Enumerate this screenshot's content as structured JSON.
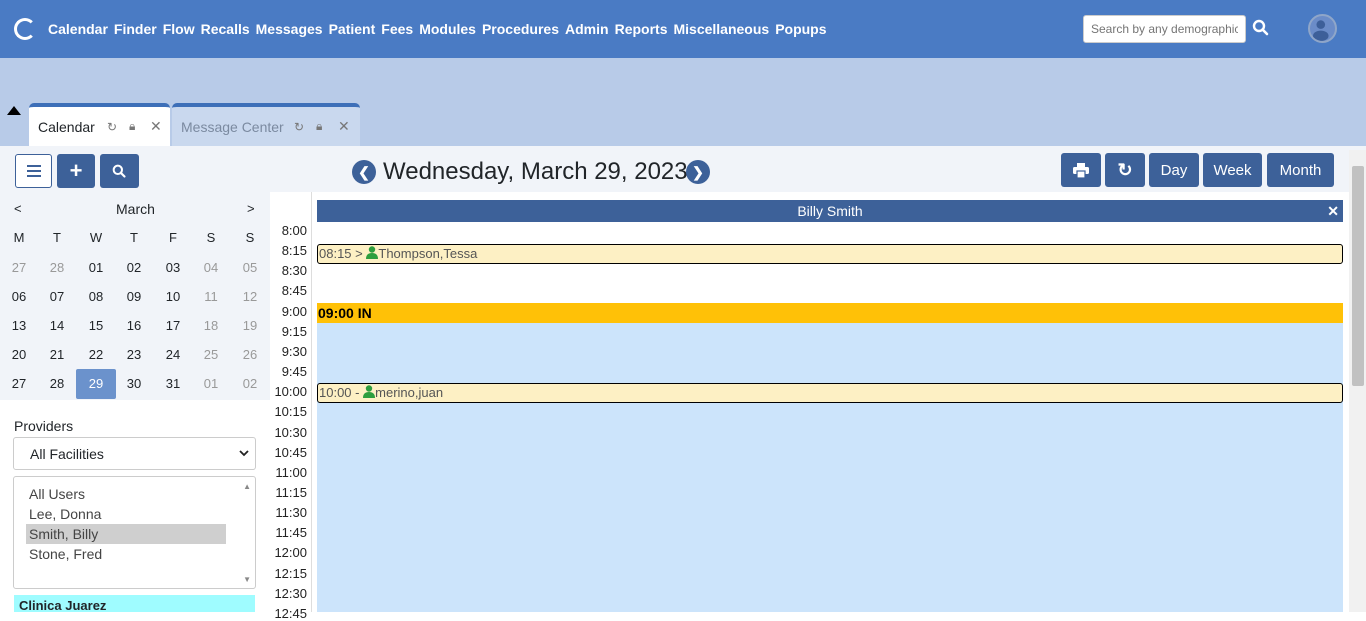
{
  "nav": {
    "menu": [
      "Calendar",
      "Finder",
      "Flow",
      "Recalls",
      "Messages",
      "Patient",
      "Fees",
      "Modules",
      "Procedures",
      "Admin",
      "Reports",
      "Miscellaneous",
      "Popups"
    ],
    "search_placeholder": "Search by any demographics"
  },
  "tabs": [
    {
      "label": "Calendar"
    },
    {
      "label": "Message Center"
    }
  ],
  "toolbar": {
    "date": "Wednesday, March 29, 2023",
    "day": "Day",
    "week": "Week",
    "month": "Month"
  },
  "mini_calendar": {
    "prev": "<",
    "next": ">",
    "month": "March",
    "weekdays": [
      "M",
      "T",
      "W",
      "T",
      "F",
      "S",
      "S"
    ],
    "weeks": [
      [
        "27",
        "28",
        "01",
        "02",
        "03",
        "04",
        "05"
      ],
      [
        "06",
        "07",
        "08",
        "09",
        "10",
        "11",
        "12"
      ],
      [
        "13",
        "14",
        "15",
        "16",
        "17",
        "18",
        "19"
      ],
      [
        "20",
        "21",
        "22",
        "23",
        "24",
        "25",
        "26"
      ],
      [
        "27",
        "28",
        "29",
        "30",
        "31",
        "01",
        "02"
      ]
    ],
    "selected": "29"
  },
  "providers": {
    "label": "Providers",
    "facility": "All Facilities",
    "users": [
      "All Users",
      "Lee, Donna",
      "Smith, Billy",
      "Stone, Fred"
    ],
    "selected_user": "Smith, Billy",
    "clinic": "Clinica Juarez"
  },
  "schedule": {
    "provider": "Billy Smith",
    "times": [
      "8:00",
      "8:15",
      "8:30",
      "8:45",
      "9:00",
      "9:15",
      "9:30",
      "9:45",
      "10:00",
      "10:15",
      "10:30",
      "10:45",
      "11:00",
      "11:15",
      "11:30",
      "11:45",
      "12:00",
      "12:15",
      "12:30",
      "12:45"
    ],
    "in_label": "09:00 IN",
    "appointments": [
      {
        "time": "08:15",
        "mark": ">",
        "patient": "Thompson,Tessa"
      },
      {
        "time": "10:00",
        "mark": "-",
        "patient": "merino,juan"
      }
    ]
  },
  "colors": {
    "nav": "#4a7bc4",
    "primary": "#3d6199",
    "in_bar": "#ffc107",
    "appt": "#fdf0c4",
    "patient_icon": "#2e9e3e"
  }
}
